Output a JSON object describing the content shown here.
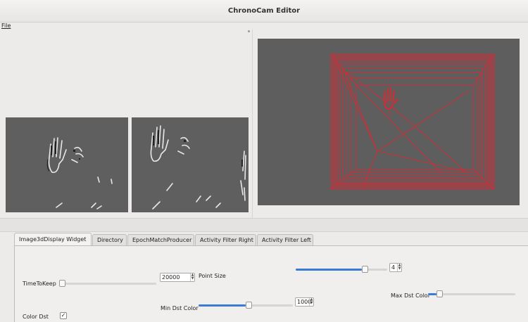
{
  "window": {
    "title": "ChronoCam Editor"
  },
  "menu": {
    "items": [
      {
        "label": "File"
      }
    ]
  },
  "tabs": [
    {
      "label": "Image3dDisplay Widget",
      "active": true
    },
    {
      "label": "Directory",
      "active": false
    },
    {
      "label": "EpochMatchProducer",
      "active": false
    },
    {
      "label": "Activity Filter Right",
      "active": false
    },
    {
      "label": "Activity Filter Left",
      "active": false
    }
  ],
  "controls": {
    "time_to_keep": {
      "label": "TimeToKeep",
      "value": "20000",
      "slider_fraction": 0.0
    },
    "point_size": {
      "label": "Point Size",
      "value": "4",
      "slider_fraction": 0.72
    },
    "min_dst_color": {
      "label": "Min Dst Color",
      "value": "1000",
      "slider_fraction": 0.5
    },
    "max_dst_color": {
      "label": "Max Dst Color",
      "slider_fraction": 0.1
    },
    "color_dst": {
      "label": "Color Dst",
      "checked": true,
      "check_mark": "✓"
    }
  },
  "colors": {
    "accent": "#3a7bd5",
    "view_background": "#5e5e5e",
    "point_cloud": "#e2262e"
  },
  "icons": {
    "spin_up": "▲",
    "spin_down": "▼"
  }
}
